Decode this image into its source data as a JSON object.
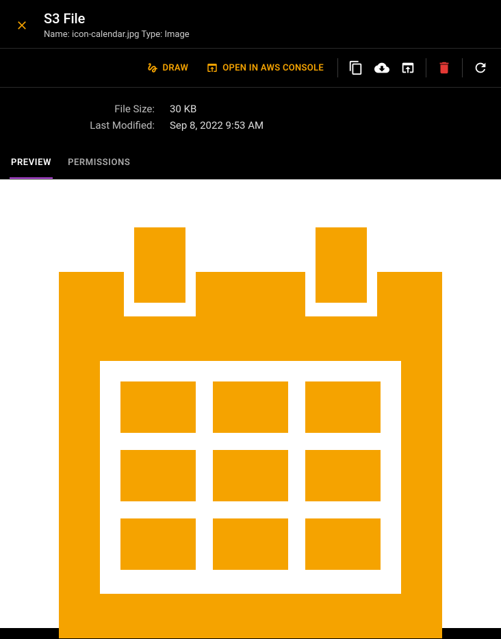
{
  "header": {
    "title": "S3 File",
    "subtitle_name_label": "Name:",
    "subtitle_name_value": "icon-calendar.jpg",
    "subtitle_type_label": "Type:",
    "subtitle_type_value": "Image"
  },
  "toolbar": {
    "draw_label": "DRAW",
    "open_label": "OPEN IN AWS CONSOLE"
  },
  "meta": {
    "file_size_label": "File Size:",
    "file_size_value": "30 KB",
    "last_modified_label": "Last Modified:",
    "last_modified_value": "Sep 8, 2022 9:53 AM"
  },
  "tabs": {
    "preview": "PREVIEW",
    "permissions": "PERMISSIONS"
  },
  "colors": {
    "accent": "#f5a300",
    "tab_active": "#b84be0",
    "delete": "#e53935",
    "calendar": "#f5a300"
  },
  "preview": {
    "image_semantic": "calendar-icon"
  }
}
